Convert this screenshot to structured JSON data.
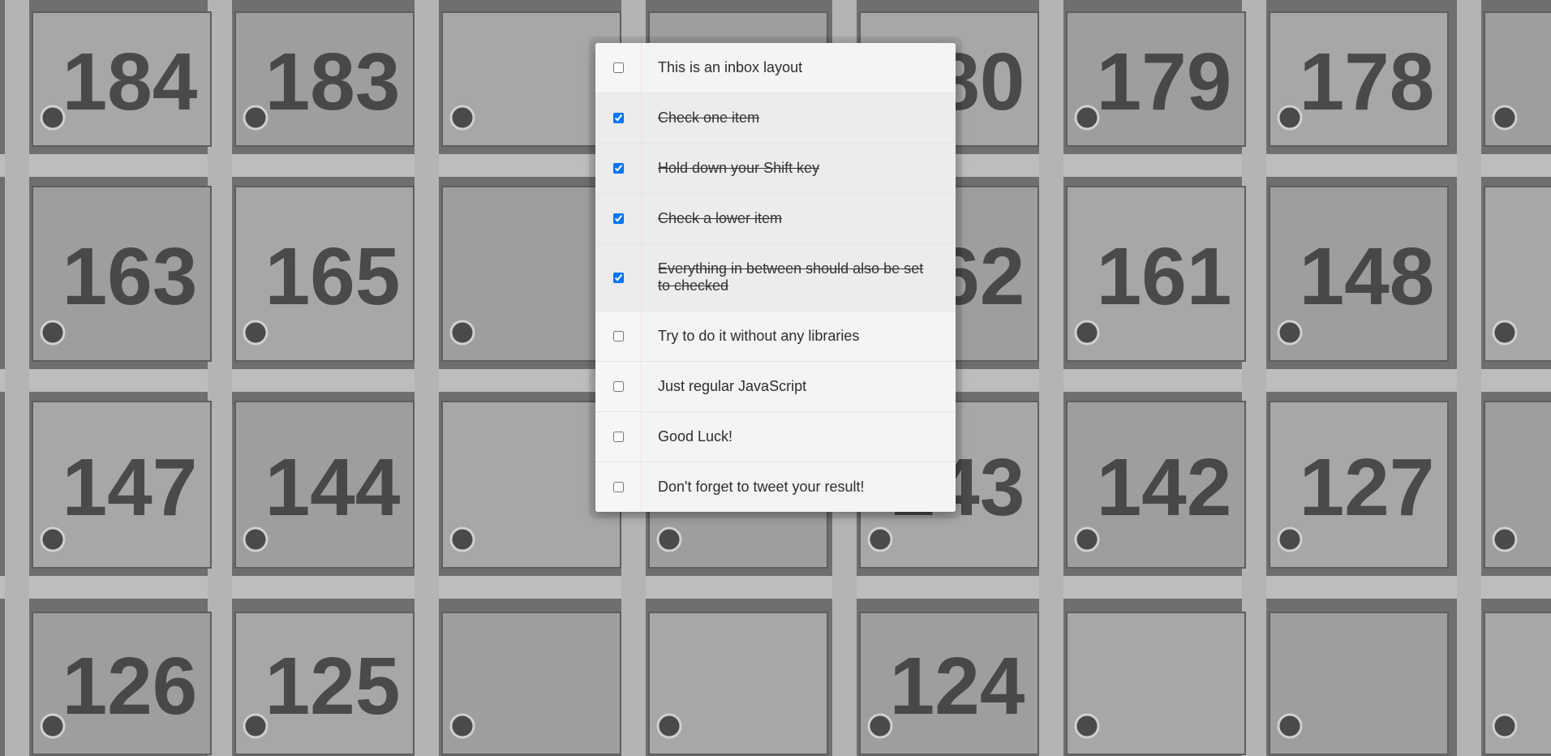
{
  "background": {
    "description_icon": "mailbox-wall",
    "box_numbers": [
      "184",
      "183",
      "180",
      "179",
      "178",
      "163",
      "165",
      "162",
      "161",
      "148",
      "147",
      "144",
      "143",
      "142",
      "127",
      "126",
      "125",
      "124"
    ]
  },
  "inbox": {
    "items": [
      {
        "label": "This is an inbox layout",
        "checked": false
      },
      {
        "label": "Check one item",
        "checked": true
      },
      {
        "label": "Hold down your Shift key",
        "checked": true
      },
      {
        "label": "Check a lower item",
        "checked": true
      },
      {
        "label": "Everything in between should also be set to checked",
        "checked": true
      },
      {
        "label": "Try to do it without any libraries",
        "checked": false
      },
      {
        "label": "Just regular JavaScript",
        "checked": false
      },
      {
        "label": "Good Luck!",
        "checked": false
      },
      {
        "label": "Don't forget to tweet your result!",
        "checked": false
      }
    ]
  },
  "colors": {
    "panel_bg": "#f4f4f4",
    "checked_bg": "#ececec",
    "text": "#2d2d2d"
  }
}
